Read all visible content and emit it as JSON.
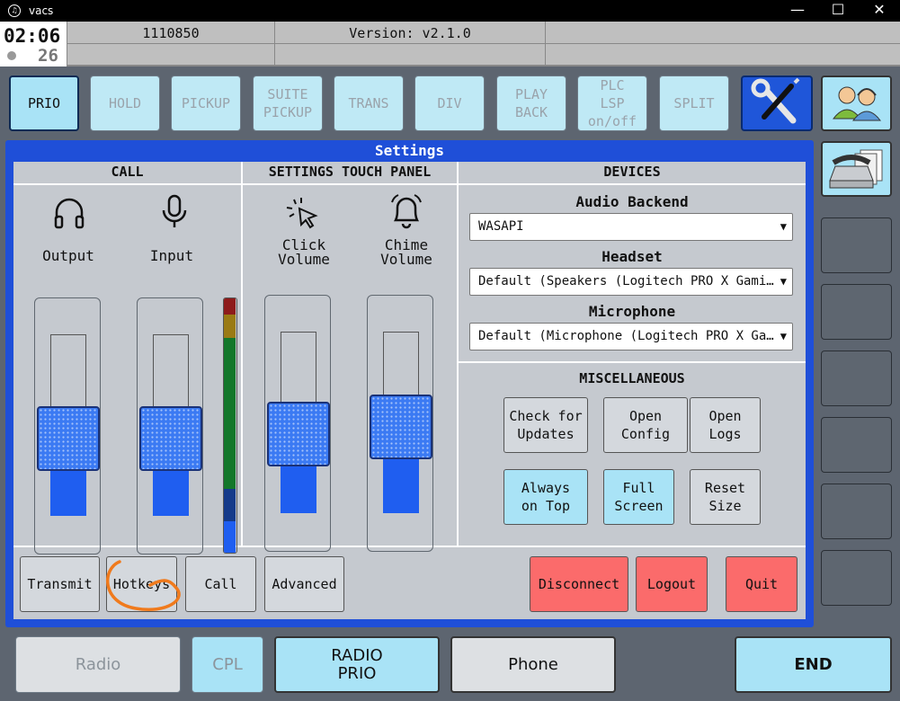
{
  "window": {
    "title": "vacs",
    "minimize": "—",
    "maximize": "☐",
    "close": "✕"
  },
  "status_bar": {
    "time": "02:06",
    "seconds": "26",
    "callsign": "1110850",
    "version": "Version: v2.1.0"
  },
  "top_buttons": [
    {
      "label": "PRIO",
      "active": true
    },
    {
      "label": "HOLD",
      "active": false
    },
    {
      "label": "PICKUP",
      "active": false
    },
    {
      "label": "SUITE\nPICKUP",
      "active": false
    },
    {
      "label": "TRANS",
      "active": false
    },
    {
      "label": "DIV",
      "active": false
    },
    {
      "label": "PLAY\nBACK",
      "active": false
    },
    {
      "label": "PLC\nLSP\non/off",
      "active": false
    },
    {
      "label": "SPLIT",
      "active": false
    }
  ],
  "settings": {
    "title": "Settings",
    "call": {
      "header": "CALL",
      "output_label": "Output",
      "input_label": "Input",
      "output_level": 0.46,
      "input_level": 0.46
    },
    "touch_panel": {
      "header": "SETTINGS TOUCH PANEL",
      "click_label": "Click\nVolume",
      "chime_label": "Chime\nVolume",
      "click_level": 0.48,
      "chime_level": 0.54
    },
    "devices": {
      "header": "DEVICES",
      "audio_backend_label": "Audio Backend",
      "audio_backend_value": "WASAPI",
      "headset_label": "Headset",
      "headset_value": "Default (Speakers (Logitech PRO X Gami…",
      "microphone_label": "Microphone",
      "microphone_value": "Default (Microphone (Logitech PRO X Ga…"
    },
    "misc": {
      "header": "MISCELLANEOUS",
      "check_updates": "Check for\nUpdates",
      "open_config": "Open\nConfig",
      "open_logs": "Open\nLogs",
      "always_on_top": "Always\non Top",
      "full_screen": "Full\nScreen",
      "reset_size": "Reset\nSize"
    },
    "bottom": {
      "transmit": "Transmit",
      "hotkeys": "Hotkeys",
      "call": "Call",
      "advanced": "Advanced",
      "disconnect": "Disconnect",
      "logout": "Logout",
      "quit": "Quit"
    }
  },
  "bottom_bar": {
    "radio": "Radio",
    "cpl": "CPL",
    "radio_prio": "RADIO\nPRIO",
    "phone": "Phone",
    "end": "END"
  },
  "colors": {
    "accent": "#1f4fd8",
    "button_on": "#a9e3f6",
    "danger": "#fb6b6b",
    "highlight_circle": "#f07a1c"
  }
}
